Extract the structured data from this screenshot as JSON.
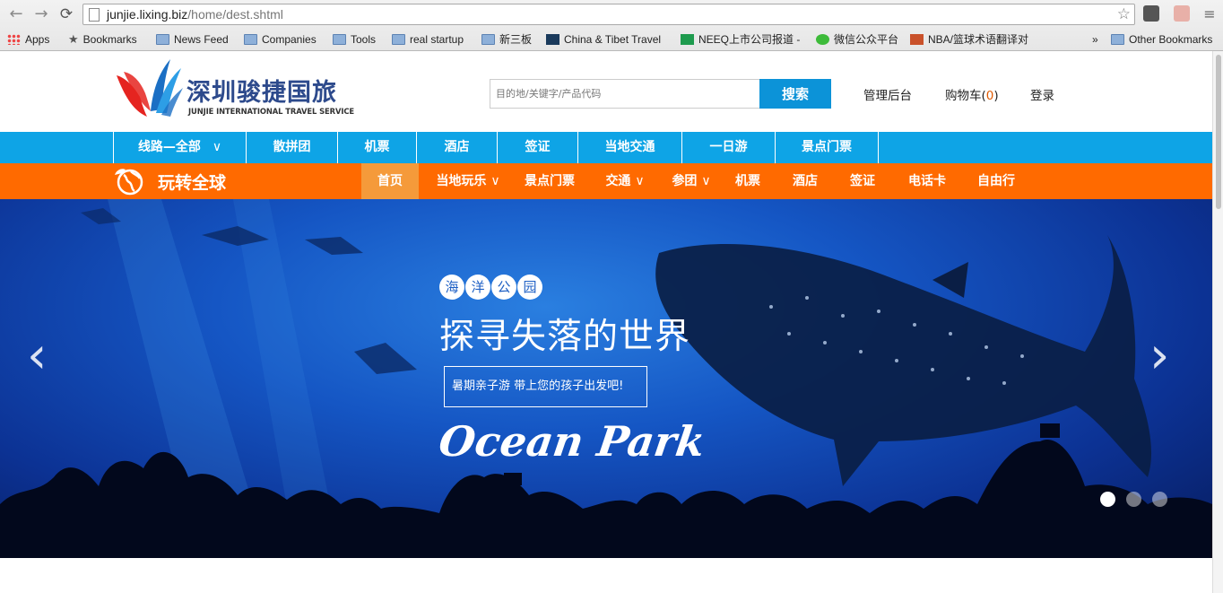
{
  "browser": {
    "url_host": "junjie.lixing.biz",
    "url_path": "/home/dest.shtml",
    "bookmarks": [
      "Apps",
      "Bookmarks",
      "News Feed",
      "Companies",
      "Tools",
      "real startup",
      "新三板",
      "China & Tibet Travel",
      "NEEQ上市公司报道 -",
      "微信公众平台",
      "NBA/篮球术语翻译对",
      "»",
      "Other Bookmarks"
    ]
  },
  "header": {
    "logo_cn": "深圳骏捷国旅",
    "logo_en": "JUNJIE INTERNATIONAL TRAVEL SERVICE",
    "search_placeholder": "目的地/关键字/产品代码",
    "search_button": "搜索",
    "admin_link": "管理后台",
    "cart_label": "购物车(",
    "cart_count": "0",
    "cart_close": ")",
    "login_link": "登录"
  },
  "bluenav": [
    "线路—全部",
    "散拼团",
    "机票",
    "酒店",
    "签证",
    "当地交通",
    "一日游",
    "景点门票"
  ],
  "orangenav": {
    "brand": "玩转全球",
    "items": [
      "首页",
      "当地玩乐",
      "景点门票",
      "交通",
      "参团",
      "机票",
      "酒店",
      "签证",
      "电话卡",
      "自由行"
    ]
  },
  "banner": {
    "tag_chars": [
      "海",
      "洋",
      "公",
      "园"
    ],
    "headline": "探寻失落的世界",
    "subline": "暑期亲子游  带上您的孩子出发吧!",
    "script_title": "Ocean Park",
    "prev_arrow": "‹",
    "next_arrow": "›",
    "slide_count": 3,
    "active_slide": 1
  },
  "colors": {
    "blue_nav": "#0ea4e6",
    "orange_nav": "#ff6a00",
    "search_button": "#0c93d8"
  }
}
